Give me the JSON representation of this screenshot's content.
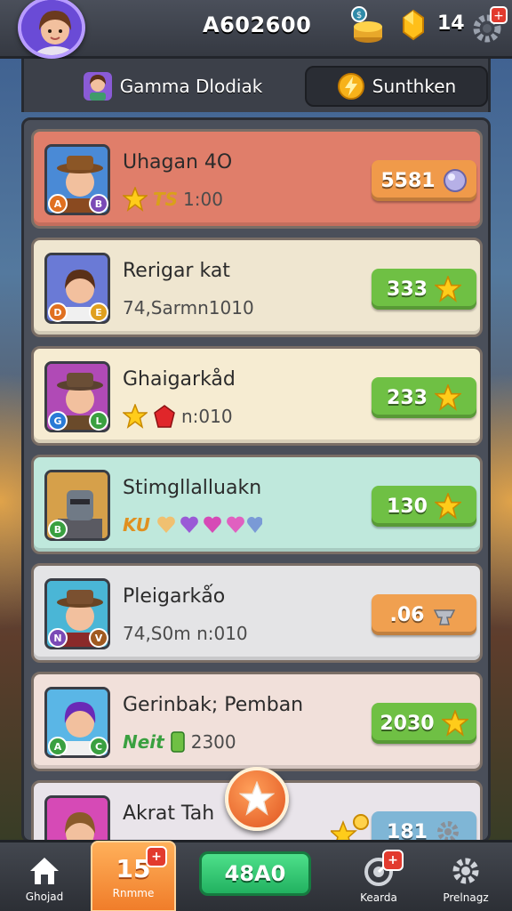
{
  "header": {
    "score": "A602600",
    "gem_count": "14",
    "colors": {
      "bar": "#3f434c",
      "avatar_ring": "#b89cff"
    },
    "icons": [
      "player-avatar-icon",
      "coin-stack-icon",
      "gem-icon",
      "settings-icon"
    ]
  },
  "tabs": [
    {
      "label": "Gammа Dlodiak",
      "icon": "character-icon"
    },
    {
      "label": "Sunthken",
      "icon": "lightning-coin-icon"
    }
  ],
  "cards": [
    {
      "name": "Uhagan 4O",
      "sub_text": "1:00",
      "sub_prefix": "TS",
      "reward": "5581",
      "reward_icon": "orb-icon",
      "bg": "#e07e6a",
      "reward_color": "#f09a4a",
      "badges": [
        "A",
        "B"
      ]
    },
    {
      "name": "Rerigar kat",
      "sub_text": "74,Sarmn1010",
      "sub_prefix": "",
      "reward": "333",
      "reward_icon": "star-icon",
      "bg": "#efe6d0",
      "reward_color": "#6fc044",
      "badges": [
        "D",
        "E"
      ]
    },
    {
      "name": "Ghaigarkåd",
      "sub_text": "n:010",
      "sub_prefix": "",
      "reward": "233",
      "reward_icon": "star-icon",
      "bg": "#f6ecd2",
      "reward_color": "#6fc044",
      "badges": [
        "G",
        "L"
      ]
    },
    {
      "name": "Stimgllalluakn",
      "sub_text": "",
      "sub_prefix": "KU",
      "reward": "130",
      "reward_icon": "star-icon",
      "bg": "#bfe8dc",
      "reward_color": "#6fc044",
      "badges": [
        "B"
      ]
    },
    {
      "name": "Pleigarkǻo",
      "sub_text": "74,S0m n:010",
      "sub_prefix": "",
      "reward": ".06",
      "reward_icon": "anvil-icon",
      "bg": "#e4e4e6",
      "reward_color": "#f0a050",
      "badges": [
        "N",
        "V"
      ]
    },
    {
      "name": "Gerinbak; Pemban",
      "sub_text": "2300",
      "sub_prefix": "Neit",
      "reward": "2030",
      "reward_icon": "star-icon",
      "bg": "#f1e0da",
      "reward_color": "#6fc044",
      "badges": [
        "A",
        "C"
      ]
    },
    {
      "name": "Akrat Tah",
      "sub_text": "",
      "sub_prefix": "",
      "reward": "181",
      "reward_icon": "gear-icon",
      "bg": "#e9e4ea",
      "reward_color": "#7fb6d6",
      "badges": []
    }
  ],
  "nav": {
    "home_label": "Ghojad",
    "games_count": "15",
    "games_label": "Rnmme",
    "games_badge": "+",
    "play_label": "48A0",
    "rank_label": "Kearda",
    "rank_badge": "+",
    "settings_label": "Prelnagz"
  }
}
